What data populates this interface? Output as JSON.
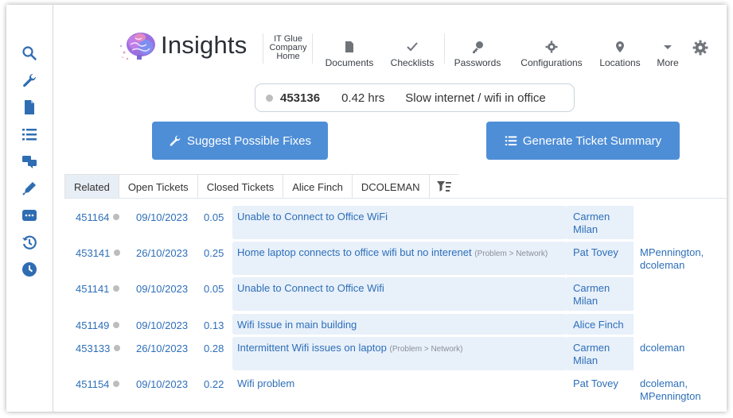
{
  "app": {
    "logo_text": "Insights"
  },
  "nav": {
    "home": [
      "IT Glue",
      "Company",
      "Home"
    ],
    "documents": "Documents",
    "checklists": "Checklists",
    "passwords": "Passwords",
    "configurations": "Configurations",
    "locations": "Locations",
    "more": "More"
  },
  "sidebar_icons": [
    "search-icon",
    "wrench-icon",
    "document-icon",
    "list-icon",
    "chat-icon",
    "pen-icon",
    "ellipsis-icon",
    "history-icon",
    "clock-icon"
  ],
  "ticket": {
    "number": "453136",
    "hours": "0.42 hrs",
    "title": "Slow internet / wifi in office",
    "status_color": "#bdbdbd"
  },
  "actions": {
    "suggest": "Suggest Possible Fixes",
    "summary": "Generate Ticket Summary",
    "button_color": "#4e8ed7"
  },
  "tabs": [
    "Related",
    "Open Tickets",
    "Closed Tickets",
    "Alice Finch",
    "DCOLEMAN"
  ],
  "related": [
    {
      "id": "451164",
      "date": "09/10/2023",
      "hrs": "0.05",
      "subject": "Unable to Connect to Office WiFi",
      "category": "",
      "assignee": "Carmen Milan",
      "others": ""
    },
    {
      "id": "453141",
      "date": "26/10/2023",
      "hrs": "0.25",
      "subject": "Home laptop connects to office wifi but no interenet",
      "category": "(Problem > Network)",
      "assignee": "Pat Tovey",
      "others": "MPennington, dcoleman"
    },
    {
      "id": "451141",
      "date": "09/10/2023",
      "hrs": "0.05",
      "subject": "Unable to Connect to Office Wifi",
      "category": "",
      "assignee": "Carmen Milan",
      "others": ""
    },
    {
      "id": "451149",
      "date": "09/10/2023",
      "hrs": "0.13",
      "subject": "Wifi Issue in main building",
      "category": "",
      "assignee": "Alice Finch",
      "others": ""
    },
    {
      "id": "453133",
      "date": "26/10/2023",
      "hrs": "0.28",
      "subject": "Intermittent Wifi issues on laptop",
      "category": "(Problem > Network)",
      "assignee": "Carmen Milan",
      "others": "dcoleman"
    },
    {
      "id": "451154",
      "date": "09/10/2023",
      "hrs": "0.22",
      "subject": "Wifi problem",
      "category": "",
      "assignee": "Pat Tovey",
      "others": "dcoleman, MPennington"
    }
  ]
}
